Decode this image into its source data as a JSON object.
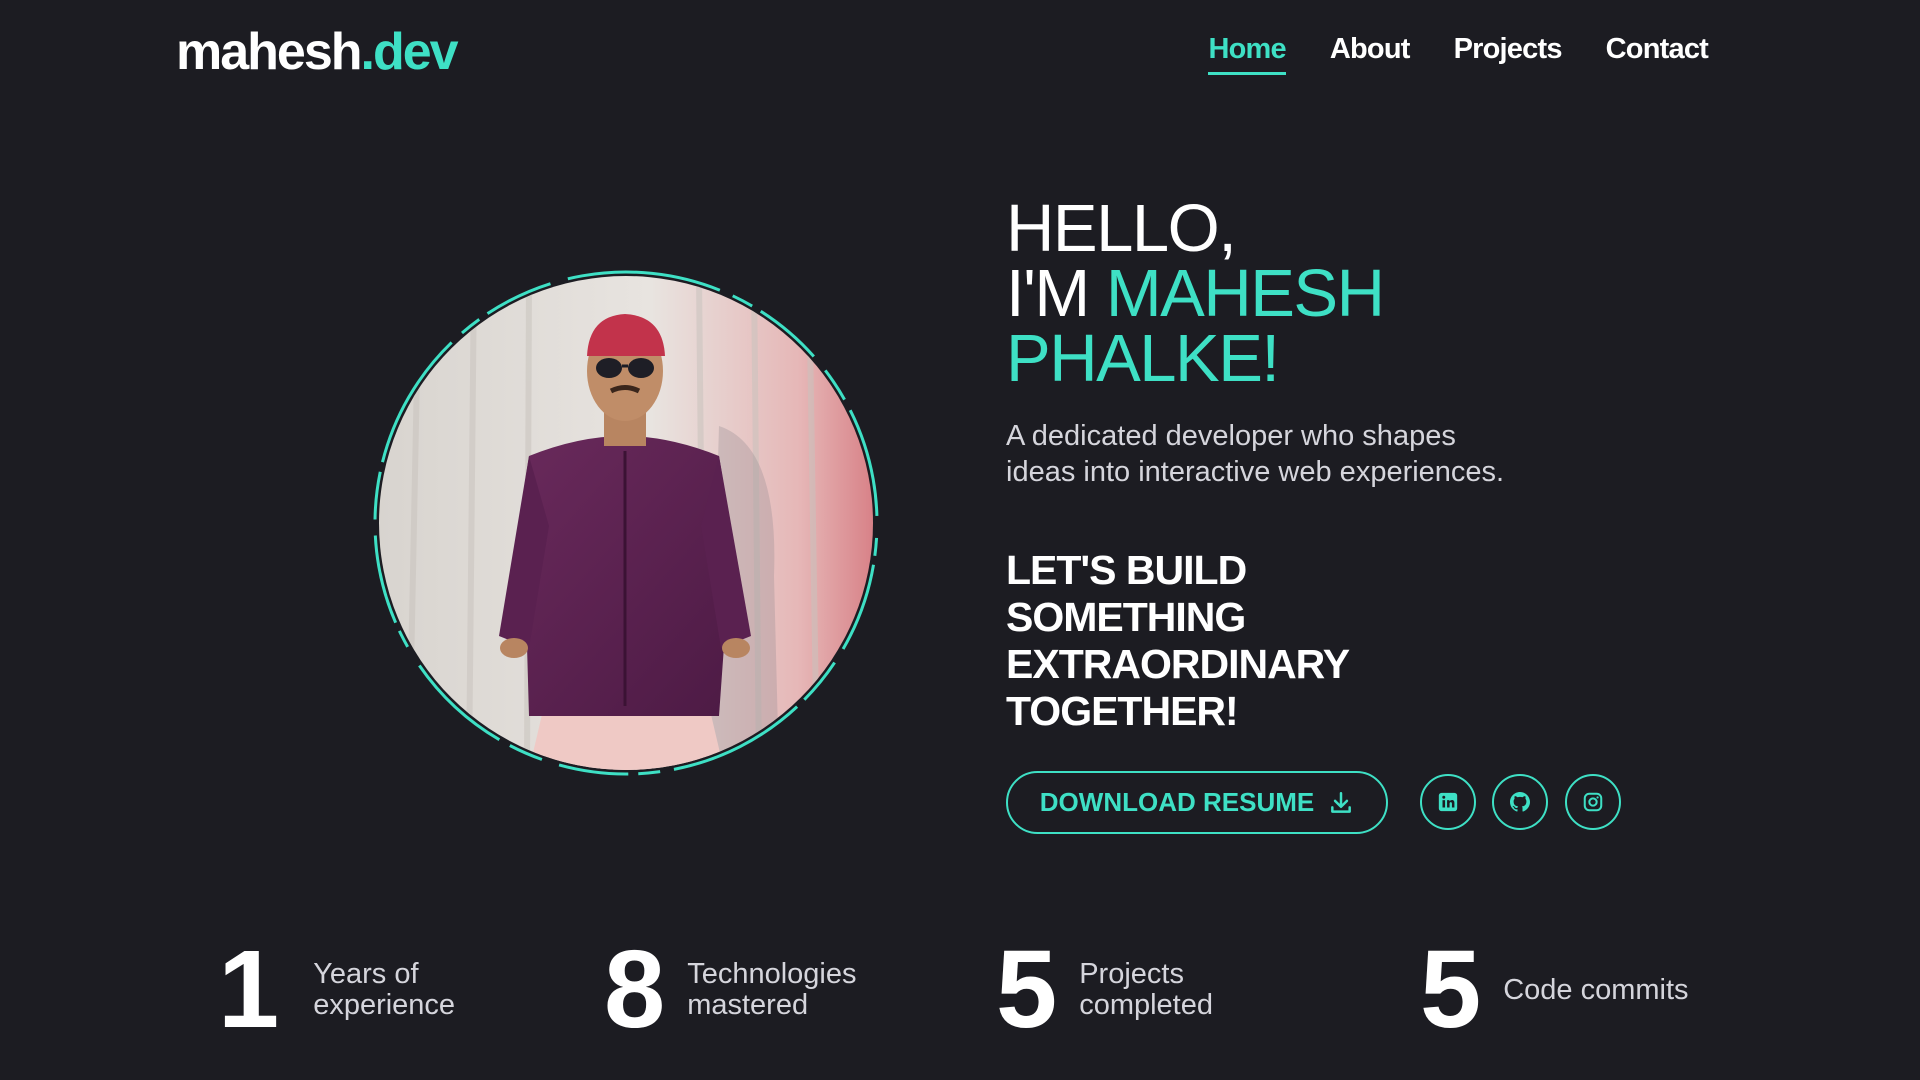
{
  "header": {
    "logo_main": "mahesh",
    "logo_accent": ".dev",
    "nav": [
      {
        "label": "Home"
      },
      {
        "label": "About"
      },
      {
        "label": "Projects"
      },
      {
        "label": "Contact"
      }
    ]
  },
  "hero": {
    "line1": "HELLO,",
    "line2_prefix": "I'M ",
    "line2_accent": "MAHESH",
    "line3_accent": "PHALKE!",
    "description": "A dedicated developer who shapes ideas into interactive web experiences.",
    "cta_lines": [
      "LET'S BUILD",
      "SOMETHING",
      "EXTRAORDINARY",
      "TOGETHER!"
    ]
  },
  "actions": {
    "resume_label": "DOWNLOAD RESUME",
    "resume_icon": "download-icon",
    "social": [
      {
        "icon": "linkedin-icon"
      },
      {
        "icon": "github-icon"
      },
      {
        "icon": "instagram-icon"
      }
    ]
  },
  "stats": [
    {
      "number": "1",
      "label": "Years of experience"
    },
    {
      "number": "8",
      "label": "Technologies mastered"
    },
    {
      "number": "5",
      "label": "Projects completed"
    },
    {
      "number": "5",
      "label": "Code commits"
    }
  ],
  "colors": {
    "background": "#1c1c22",
    "accent": "#3ee0c5",
    "text": "#ffffff",
    "muted_text": "#d5d5dc"
  }
}
